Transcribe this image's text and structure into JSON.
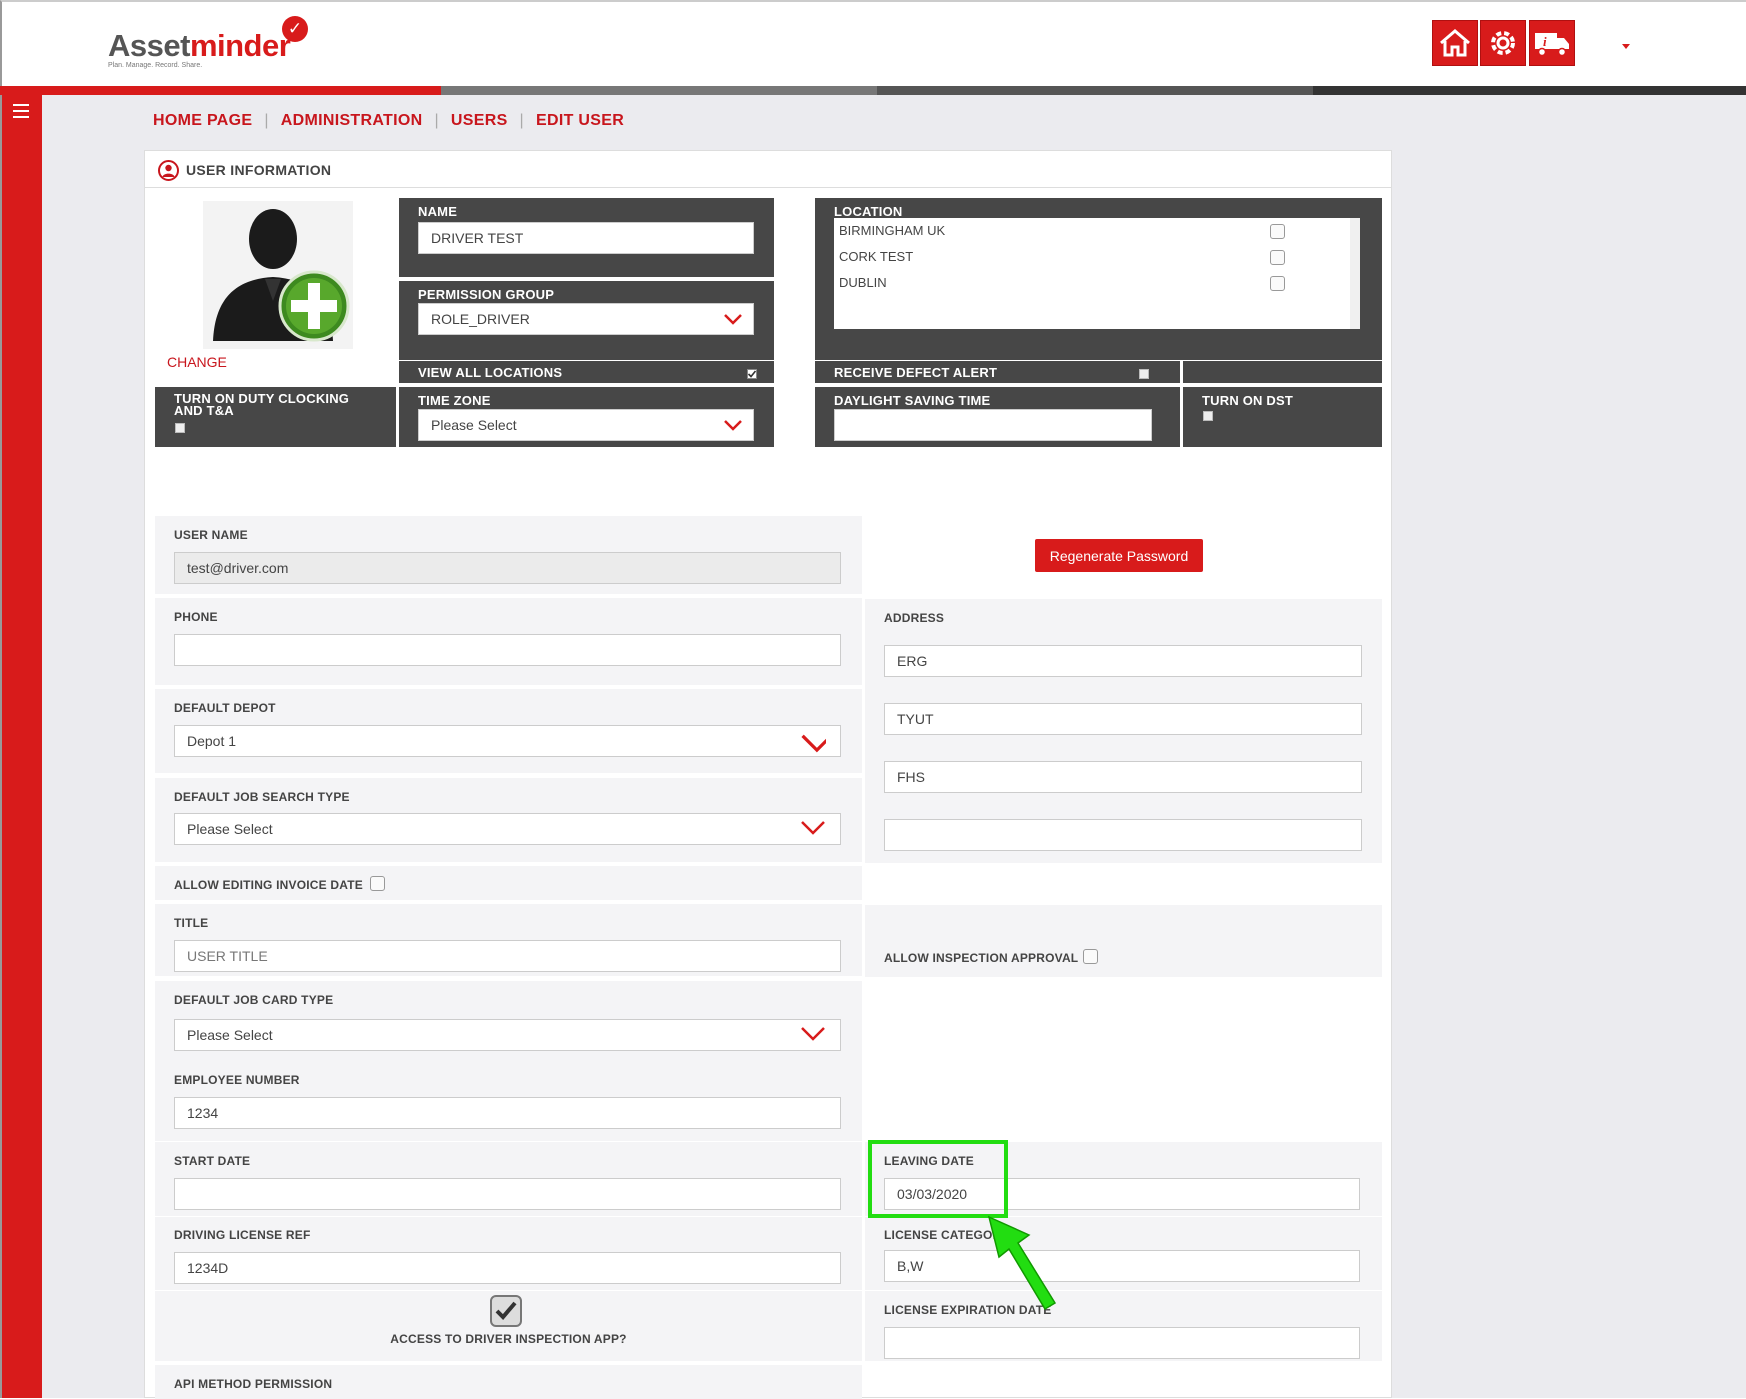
{
  "app": {
    "logo_part1": "Asset",
    "logo_part2": "minder",
    "tagline": "Plan. Manage. Record. Share."
  },
  "topnav": {
    "icons": [
      "home-icon",
      "gear-icon",
      "truck-info-icon"
    ]
  },
  "breadcrumb": [
    "HOME PAGE",
    "ADMINISTRATION",
    "USERS",
    "EDIT USER"
  ],
  "panel": {
    "title": "USER INFORMATION"
  },
  "profile": {
    "change_label": "CHANGE"
  },
  "name": {
    "label": "NAME",
    "value": "DRIVER TEST"
  },
  "permission_group": {
    "label": "PERMISSION GROUP",
    "value": "ROLE_DRIVER"
  },
  "location": {
    "label": "LOCATION",
    "items": [
      "BIRMINGHAM UK",
      "CORK TEST",
      "DUBLIN"
    ]
  },
  "view_all_locations": {
    "label": "VIEW ALL LOCATIONS",
    "checked": true
  },
  "receive_defect_alert": {
    "label": "RECEIVE DEFECT ALERT",
    "checked": false
  },
  "duty_clocking": {
    "label_line1": "TURN ON DUTY CLOCKING",
    "label_line2": "AND T&A"
  },
  "time_zone": {
    "label": "TIME ZONE",
    "value": "Please Select"
  },
  "daylight_saving_time": {
    "label": "DAYLIGHT SAVING TIME",
    "value": ""
  },
  "turn_on_dst": {
    "label": "TURN ON DST"
  },
  "form": {
    "user_name": {
      "label": "USER NAME",
      "value": "test@driver.com"
    },
    "regenerate_password": "Regenerate Password",
    "phone": {
      "label": "PHONE",
      "value": ""
    },
    "address": {
      "label": "ADDRESS",
      "lines": [
        "ERG",
        "TYUT",
        "FHS",
        ""
      ]
    },
    "default_depot": {
      "label": "DEFAULT DEPOT",
      "value": "Depot 1"
    },
    "default_job_search_type": {
      "label": "DEFAULT JOB SEARCH TYPE",
      "value": "Please Select"
    },
    "allow_editing_invoice_date": {
      "label": "ALLOW EDITING INVOICE DATE"
    },
    "title": {
      "label": "TITLE",
      "placeholder": "USER TITLE"
    },
    "allow_inspection_approval": {
      "label": "ALLOW INSPECTION APPROVAL"
    },
    "default_job_card_type": {
      "label": "DEFAULT JOB CARD TYPE",
      "value": "Please Select"
    },
    "employee_number": {
      "label": "EMPLOYEE NUMBER",
      "value": "1234"
    },
    "start_date": {
      "label": "START DATE",
      "value": ""
    },
    "leaving_date": {
      "label": "LEAVING DATE",
      "value": "03/03/2020"
    },
    "driving_license_ref": {
      "label": "DRIVING LICENSE REF",
      "value": "1234D"
    },
    "license_category": {
      "label": "LICENSE CATEGORY",
      "value": "B,W"
    },
    "access_driver_inspection_app": {
      "label": "ACCESS TO DRIVER INSPECTION APP?",
      "checked": true
    },
    "license_expiration_date": {
      "label": "LICENSE EXPIRATION DATE",
      "value": ""
    },
    "api_method_permission": {
      "label": "API METHOD PERMISSION"
    }
  },
  "colors": {
    "brand_red": "#d81b1b",
    "dark_panel": "#474747",
    "highlight": "#22dd11"
  }
}
